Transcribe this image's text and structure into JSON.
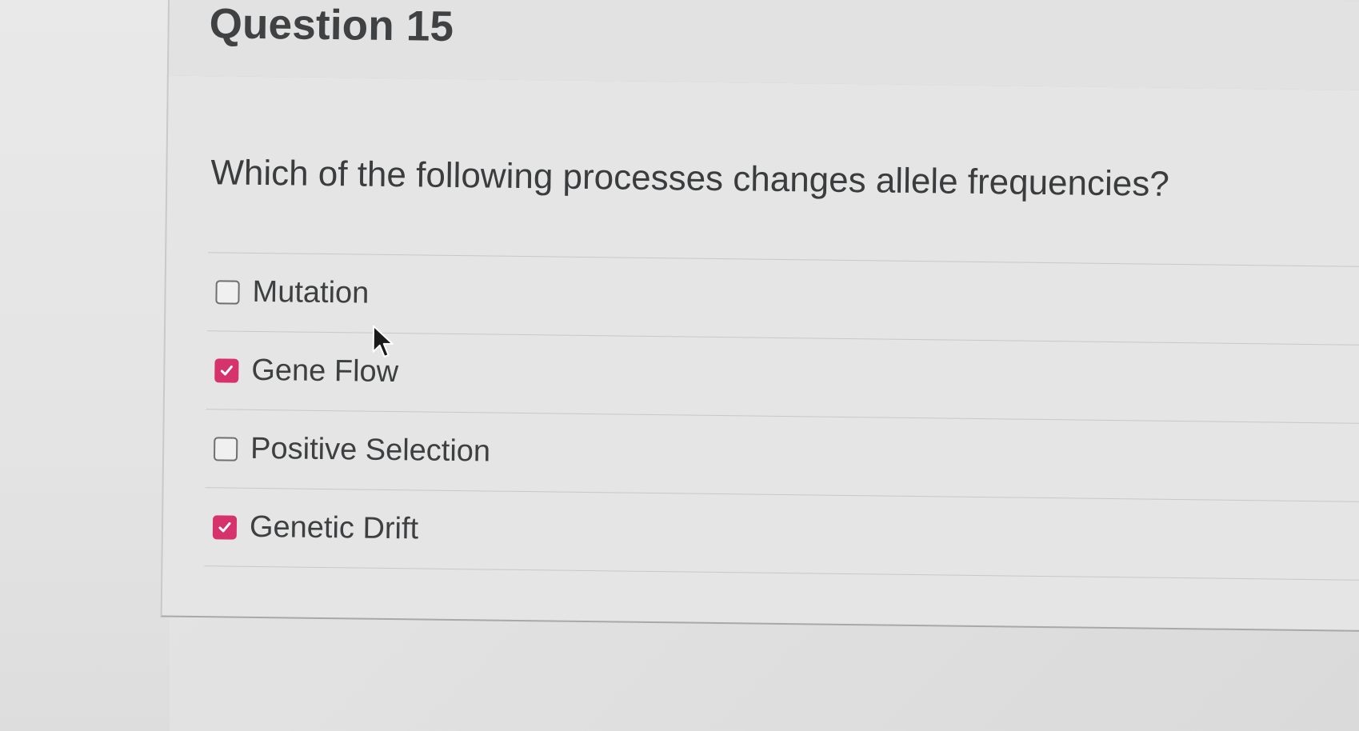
{
  "question": {
    "title": "Question 15",
    "text": "Which of the following processes changes allele frequencies?"
  },
  "answers": [
    {
      "label": "Mutation",
      "checked": false
    },
    {
      "label": "Gene Flow",
      "checked": true
    },
    {
      "label": "Positive Selection",
      "checked": false
    },
    {
      "label": "Genetic Drift",
      "checked": true
    }
  ],
  "colors": {
    "checkbox_checked": "#d6336c",
    "text": "#3d3f40"
  }
}
